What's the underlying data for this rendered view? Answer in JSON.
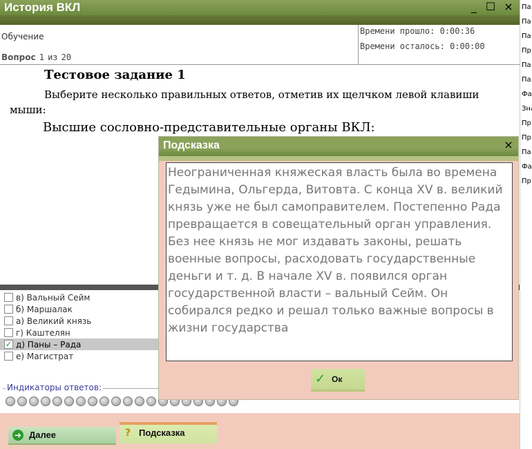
{
  "window": {
    "title": "История ВКЛ",
    "minimize": "_",
    "maximize": "☐",
    "close": "×"
  },
  "info": {
    "mode": "Обучение",
    "question_label": "Вопрос",
    "question_num": "1",
    "question_of": "из",
    "question_total": "20",
    "elapsed_label": "Времени прошло:",
    "elapsed_value": "0:00:36",
    "remaining_label": "Времени осталось:",
    "remaining_value": "0:00:00"
  },
  "question": {
    "heading": "Тестовое задание 1",
    "instruction": "Выберите несколько правильных ответов, отметив их щелчком левой клавиши мыши:",
    "text": "Высшие сословно-представительные органы ВКЛ:"
  },
  "answers": [
    {
      "label": "в) Вальный Сейм",
      "checked": false
    },
    {
      "label": "б) Маршалак",
      "checked": false
    },
    {
      "label": "а) Великий князь",
      "checked": false
    },
    {
      "label": "г) Каштелян",
      "checked": false
    },
    {
      "label": "д) Паны – Рада",
      "checked": true
    },
    {
      "label": "е) Магистрат",
      "checked": false
    }
  ],
  "indicators": {
    "label": "Индикаторы ответов:",
    "count": 20
  },
  "buttons": {
    "next": "Далее",
    "hint": "Подсказка"
  },
  "dialog": {
    "title": "Подсказка",
    "close": "×",
    "text": "Неограниченная княжеская власть была во времена Гедымина, Ольгерда, Витовта. С конца XV в. великий князь уже не был самоправителем. Постепенно Рада превращается в совещательный орган управления. Без нее князь не мог издавать законы, решать военные вопросы, расходовать государственные деньги и т. д. В начале XV в. появился орган государственной власти – вальный Сейм. Он собирался редко и решал только важные вопросы в жизни государства",
    "ok": "Ок"
  },
  "background_window": {
    "line_starts": [
      "Па",
      "Па",
      "Па",
      "Пр",
      "Па",
      "Па",
      "Фа",
      "Зна",
      "Пр",
      "Пр",
      "Па",
      "Фа",
      "Пр"
    ]
  }
}
